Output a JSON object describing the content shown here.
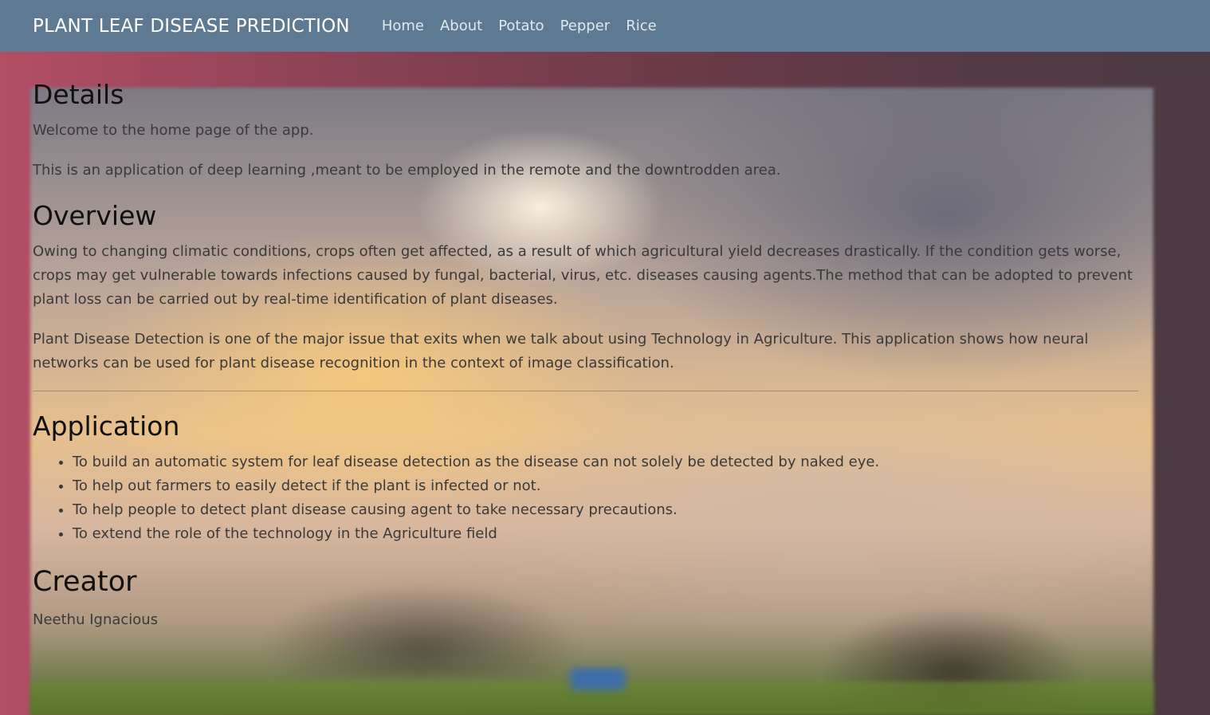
{
  "navbar": {
    "brand": "PLANT LEAF DISEASE PREDICTION",
    "links": [
      "Home",
      "About",
      "Potato",
      "Pepper",
      "Rice"
    ]
  },
  "details": {
    "heading": "Details",
    "welcome": "Welcome to the home page of the app.",
    "intro": "This is an application of deep learning ,meant to be employed in the remote and the downtrodden area."
  },
  "overview": {
    "heading": "Overview",
    "paragraph1": "Owing to changing climatic conditions, crops often get affected, as a result of which agricultural yield decreases drastically. If the condition gets worse, crops may get vulnerable towards infections caused by fungal, bacterial, virus, etc. diseases causing agents.The method that can be adopted to prevent plant loss can be carried out by real-time identification of plant diseases.",
    "paragraph2": "Plant Disease Detection is one of the major issue that exits when we talk about using Technology in Agriculture. This application shows how neural networks can be used for plant disease recognition in the context of image classification."
  },
  "application": {
    "heading": "Application",
    "items": [
      "To build an automatic system for leaf disease detection as the disease can not solely be detected by naked eye.",
      "To help out farmers to easily detect if the plant is infected or not.",
      "To help people to detect plant disease causing agent to take necessary precautions.",
      "To extend the role of the technology in the Agriculture field"
    ]
  },
  "creator": {
    "heading": "Creator",
    "name": "Neethu Ignacious"
  },
  "colors": {
    "navbar": "#5e7a92",
    "frame_left": "#b24f65",
    "frame_right": "#4b3a42"
  }
}
